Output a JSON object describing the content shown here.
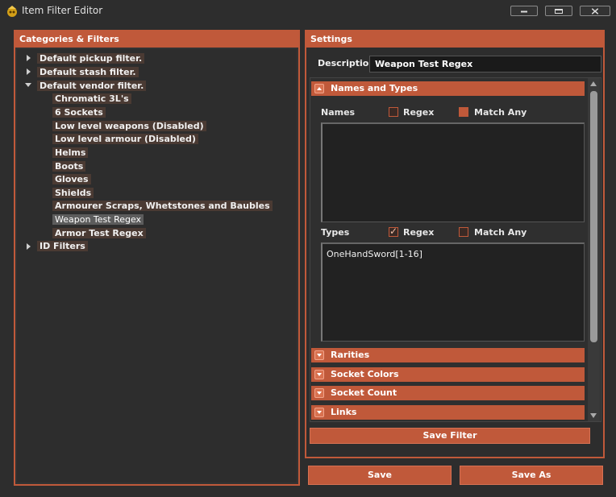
{
  "window": {
    "title": "Item Filter Editor"
  },
  "colors": {
    "accent": "#c0593a",
    "background": "#2d2d2d"
  },
  "left_panel": {
    "title": "Categories & Filters",
    "tree": [
      {
        "label": "Default pickup filter.",
        "expanded": false
      },
      {
        "label": "Default stash filter.",
        "expanded": false
      },
      {
        "label": "Default vendor filter.",
        "expanded": true,
        "children": [
          "Chromatic 3L's",
          "6 Sockets",
          "Low level weapons (Disabled)",
          "Low level armour (Disabled)",
          "Helms",
          "Boots",
          "Gloves",
          "Shields",
          "Armourer Scraps, Whetstones and Baubles",
          "Weapon Test Regex",
          "Armor Test Regex"
        ],
        "selected_child": "Weapon Test Regex"
      },
      {
        "label": "ID Filters",
        "expanded": false
      }
    ]
  },
  "settings": {
    "title": "Settings",
    "description_label": "Description",
    "description_value": "Weapon Test Regex",
    "sections": {
      "names_and_types": {
        "label": "Names and Types",
        "names_label": "Names",
        "names_regex_label": "Regex",
        "names_regex_checked": false,
        "names_match_any_label": "Match Any",
        "names_match_any_checked": false,
        "names_value": "",
        "types_label": "Types",
        "types_regex_label": "Regex",
        "types_regex_checked": true,
        "types_match_any_label": "Match Any",
        "types_match_any_checked": false,
        "types_value": "OneHandSword[1-16]"
      },
      "rarities": {
        "label": "Rarities"
      },
      "socket_colors": {
        "label": "Socket Colors"
      },
      "socket_count": {
        "label": "Socket Count"
      },
      "links": {
        "label": "Links"
      }
    },
    "save_filter_label": "Save Filter"
  },
  "footer": {
    "save_label": "Save",
    "save_as_label": "Save As"
  }
}
